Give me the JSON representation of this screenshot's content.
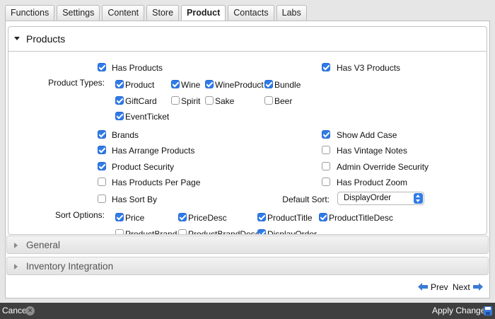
{
  "tabs": [
    "Functions",
    "Settings",
    "Content",
    "Store",
    "Product",
    "Contacts",
    "Labs"
  ],
  "active_tab": "Product",
  "products_section": {
    "title": "Products",
    "has_products": {
      "label": "Has Products",
      "checked": true
    },
    "has_v3_products": {
      "label": "Has V3 Products",
      "checked": true
    },
    "product_types_label": "Product Types:",
    "product_types": [
      {
        "label": "Product",
        "checked": true
      },
      {
        "label": "Wine",
        "checked": true
      },
      {
        "label": "WineProduct",
        "checked": true
      },
      {
        "label": "Bundle",
        "checked": true
      },
      {
        "label": "GiftCard",
        "checked": true
      },
      {
        "label": "Spirit",
        "checked": false
      },
      {
        "label": "Sake",
        "checked": false
      },
      {
        "label": "Beer",
        "checked": false
      },
      {
        "label": "EventTicket",
        "checked": true
      }
    ],
    "left_options": [
      {
        "label": "Brands",
        "checked": true
      },
      {
        "label": "Has Arrange Products",
        "checked": true
      },
      {
        "label": "Product Security",
        "checked": true
      },
      {
        "label": "Has Products Per Page",
        "checked": false
      },
      {
        "label": "Has Sort By",
        "checked": false
      }
    ],
    "right_options": [
      {
        "label": "Show Add Case",
        "checked": true
      },
      {
        "label": "Has Vintage Notes",
        "checked": false
      },
      {
        "label": "Admin Override Security",
        "checked": false
      },
      {
        "label": "Has Product Zoom",
        "checked": false
      }
    ],
    "default_sort_label": "Default Sort:",
    "default_sort_value": "DisplayOrder",
    "sort_options_label": "Sort Options:",
    "sort_options": [
      {
        "label": "Price",
        "checked": true
      },
      {
        "label": "PriceDesc",
        "checked": true
      },
      {
        "label": "ProductTitle",
        "checked": true
      },
      {
        "label": "ProductTitleDesc",
        "checked": true
      },
      {
        "label": "ProductBrand",
        "checked": false
      },
      {
        "label": "ProductBrandDesc",
        "checked": false
      },
      {
        "label": "DisplayOrder",
        "checked": true
      }
    ]
  },
  "collapsed_sections": [
    "General",
    "Inventory Integration"
  ],
  "nav": {
    "prev": "Prev",
    "next": "Next"
  },
  "bottom_bar": {
    "cancel": "Cancel",
    "apply": "Apply Changes"
  },
  "colors": {
    "accent": "#2f7be8",
    "bottom_bar": "#3f3f3f"
  },
  "icons": [
    "triangle-down-icon",
    "triangle-right-icon",
    "arrow-left-icon",
    "arrow-right-icon",
    "close-circle-icon",
    "floppy-save-icon"
  ]
}
